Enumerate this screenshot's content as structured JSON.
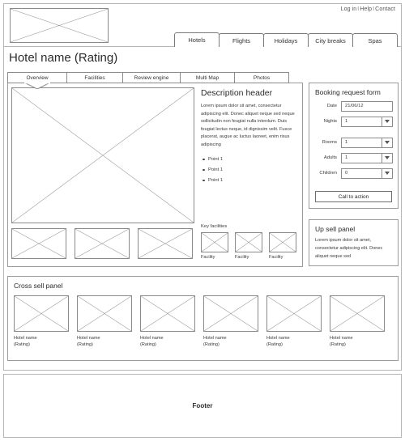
{
  "header": {
    "logo_alt": "logo-placeholder",
    "utility_links": [
      "Log in",
      "Help",
      "Contact"
    ],
    "utility_separator": "I"
  },
  "primary_tabs": [
    {
      "label": "Hotels",
      "active": true
    },
    {
      "label": "Flights",
      "active": false
    },
    {
      "label": "Holidays",
      "active": false
    },
    {
      "label": "City breaks",
      "active": false
    },
    {
      "label": "Spas",
      "active": false
    }
  ],
  "page_title": "Hotel name (Rating)",
  "secondary_tabs": [
    {
      "label": "Overview",
      "active": true
    },
    {
      "label": "Facilities",
      "active": false
    },
    {
      "label": "Review engine",
      "active": false
    },
    {
      "label": "Multi Map",
      "active": false
    },
    {
      "label": "Photos",
      "active": false
    }
  ],
  "description": {
    "header": "Description header",
    "body": "Lorem ipsum dolor sit amet, consectetur adipiscing elit. Donec aliquet neque sed neque sollicitudin non feugiat nulla interdum. Duis feugiat lectus neque, id dignissim velit. Fusce placerat, augue ac luctus laoreet, enim risus adipiscing",
    "bullets": [
      "Point 1",
      "Point 1",
      "Point 1"
    ]
  },
  "key_facilities": {
    "title": "Key facilities",
    "items": [
      {
        "label": "Facility"
      },
      {
        "label": "Facility"
      },
      {
        "label": "Facility"
      }
    ]
  },
  "booking_form": {
    "title": "Booking request form",
    "fields": [
      {
        "label": "Date",
        "value": "21/06/12",
        "type": "text"
      },
      {
        "label": "Nights",
        "value": "1",
        "type": "select"
      },
      {
        "label": "Rooms",
        "value": "1",
        "type": "select"
      },
      {
        "label": "Adults",
        "value": "1",
        "type": "select"
      },
      {
        "label": "Children",
        "value": "0",
        "type": "select"
      }
    ],
    "cta_label": "Call to action"
  },
  "upsell": {
    "title": "Up sell panel",
    "body": "Lorem ipsum dolor sit amet, consectetur adipiscing elit. Donec aliquet neque sed"
  },
  "cross_sell": {
    "title": "Cross sell panel",
    "cards": [
      {
        "name": "Hotel name",
        "rating": "(Rating)"
      },
      {
        "name": "Hotel name",
        "rating": "(Rating)"
      },
      {
        "name": "Hotel name",
        "rating": "(Rating)"
      },
      {
        "name": "Hotel name",
        "rating": "(Rating)"
      },
      {
        "name": "Hotel name",
        "rating": "(Rating)"
      },
      {
        "name": "Hotel name",
        "rating": "(Rating)"
      }
    ]
  },
  "footer": {
    "label": "Footer"
  },
  "colors": {
    "line": "#8a8a8a",
    "frame": "#b5b5b5",
    "text": "#333333"
  }
}
